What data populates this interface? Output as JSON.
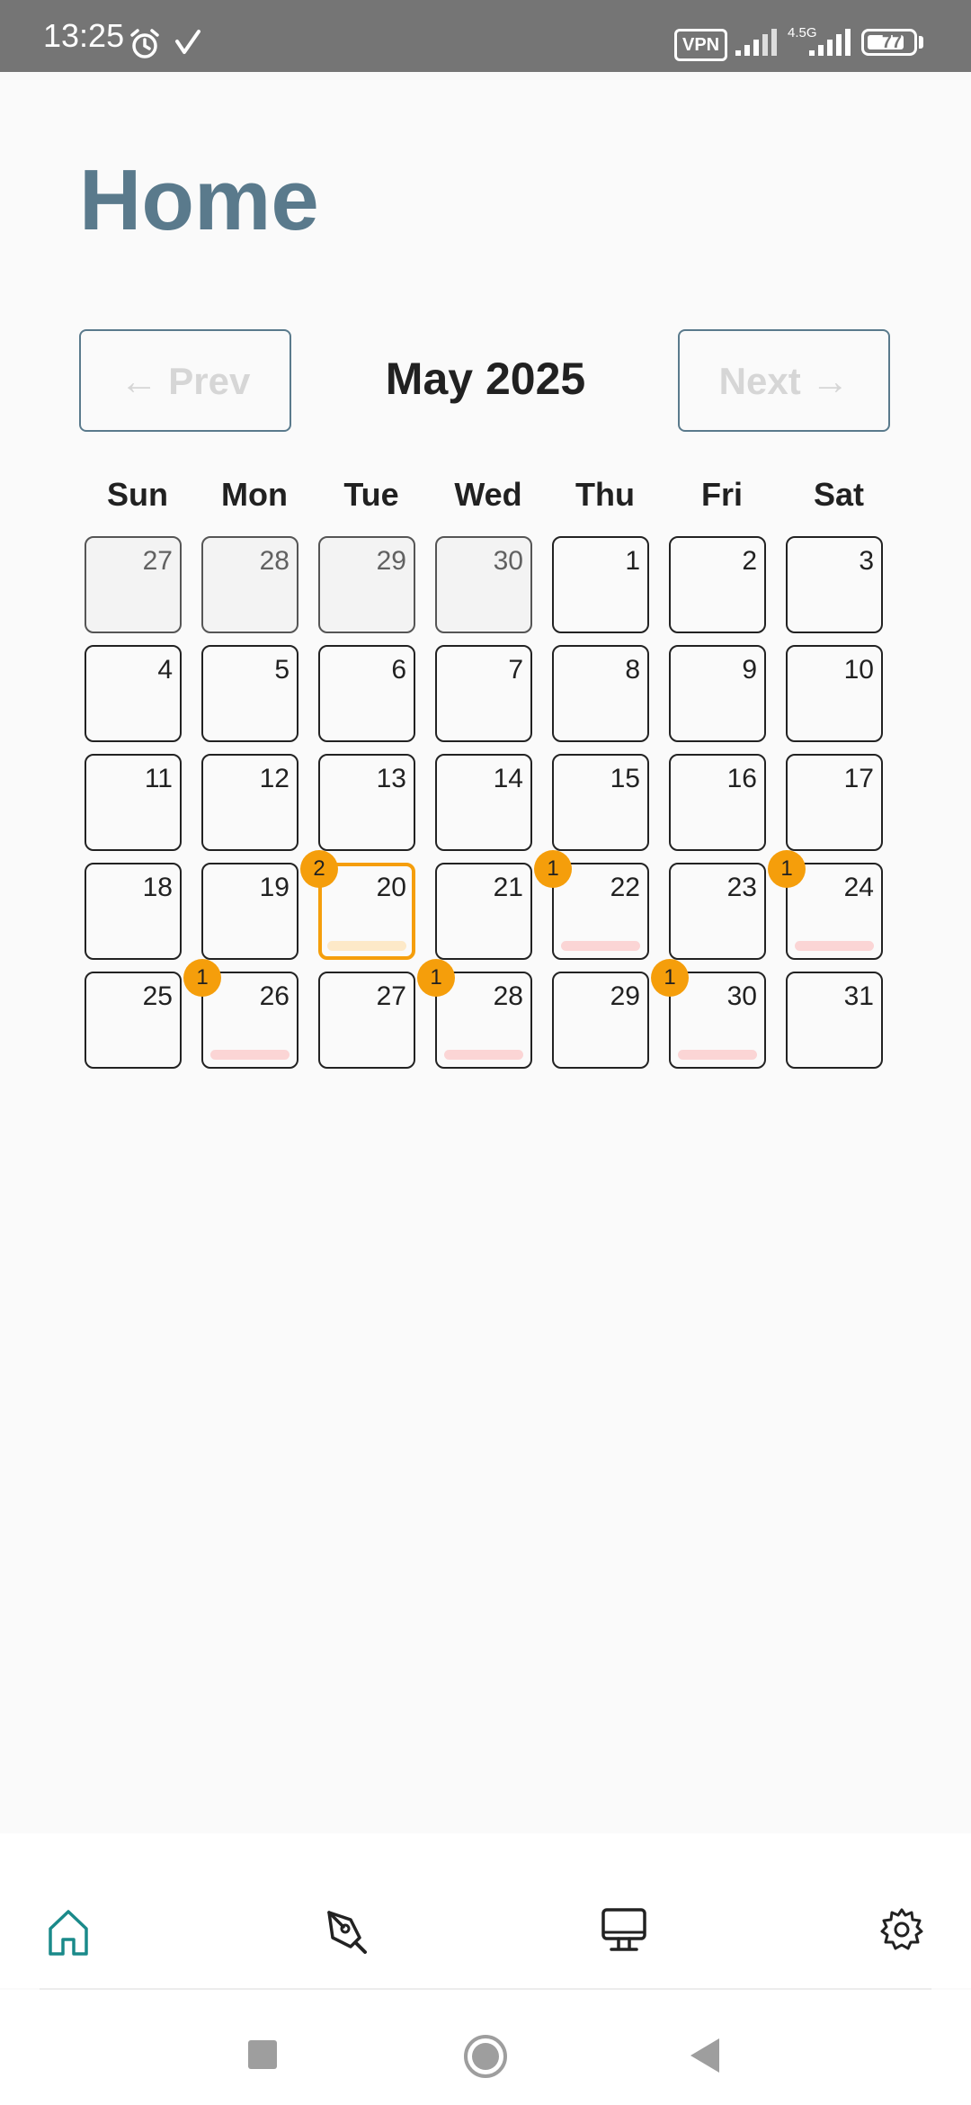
{
  "status_bar": {
    "time": "13:25",
    "vpn_label": "VPN",
    "network_type": "4.5G",
    "battery_level": "77"
  },
  "page": {
    "title": "Home"
  },
  "calendar": {
    "prev_label": "← Prev",
    "next_label": "Next →",
    "month_label": "May 2025",
    "weekdays": [
      "Sun",
      "Mon",
      "Tue",
      "Wed",
      "Thu",
      "Fri",
      "Sat"
    ],
    "weeks": [
      [
        {
          "day": "27",
          "other_month": true
        },
        {
          "day": "28",
          "other_month": true
        },
        {
          "day": "29",
          "other_month": true
        },
        {
          "day": "30",
          "other_month": true
        },
        {
          "day": "1"
        },
        {
          "day": "2"
        },
        {
          "day": "3"
        }
      ],
      [
        {
          "day": "4"
        },
        {
          "day": "5"
        },
        {
          "day": "6"
        },
        {
          "day": "7"
        },
        {
          "day": "8"
        },
        {
          "day": "9"
        },
        {
          "day": "10"
        }
      ],
      [
        {
          "day": "11"
        },
        {
          "day": "12"
        },
        {
          "day": "13"
        },
        {
          "day": "14"
        },
        {
          "day": "15"
        },
        {
          "day": "16"
        },
        {
          "day": "17"
        }
      ],
      [
        {
          "day": "18"
        },
        {
          "day": "19"
        },
        {
          "day": "20",
          "selected": true,
          "count": "2",
          "has_event": true
        },
        {
          "day": "21"
        },
        {
          "day": "22",
          "count": "1",
          "has_event": true
        },
        {
          "day": "23"
        },
        {
          "day": "24",
          "count": "1",
          "has_event": true
        }
      ],
      [
        {
          "day": "25"
        },
        {
          "day": "26",
          "count": "1",
          "has_event": true
        },
        {
          "day": "27"
        },
        {
          "day": "28",
          "count": "1",
          "has_event": true
        },
        {
          "day": "29"
        },
        {
          "day": "30",
          "count": "1",
          "has_event": true
        },
        {
          "day": "31"
        }
      ]
    ]
  },
  "colors": {
    "accent": "#f59e0b",
    "title": "#5a7a8c",
    "active_nav": "#1a8a8a",
    "event_bar": "#fbd5d5"
  },
  "bottom_nav": {
    "items": [
      {
        "icon": "home-icon",
        "active": true
      },
      {
        "icon": "pen-tool-icon"
      },
      {
        "icon": "monitor-icon"
      },
      {
        "icon": "gear-icon"
      }
    ]
  }
}
